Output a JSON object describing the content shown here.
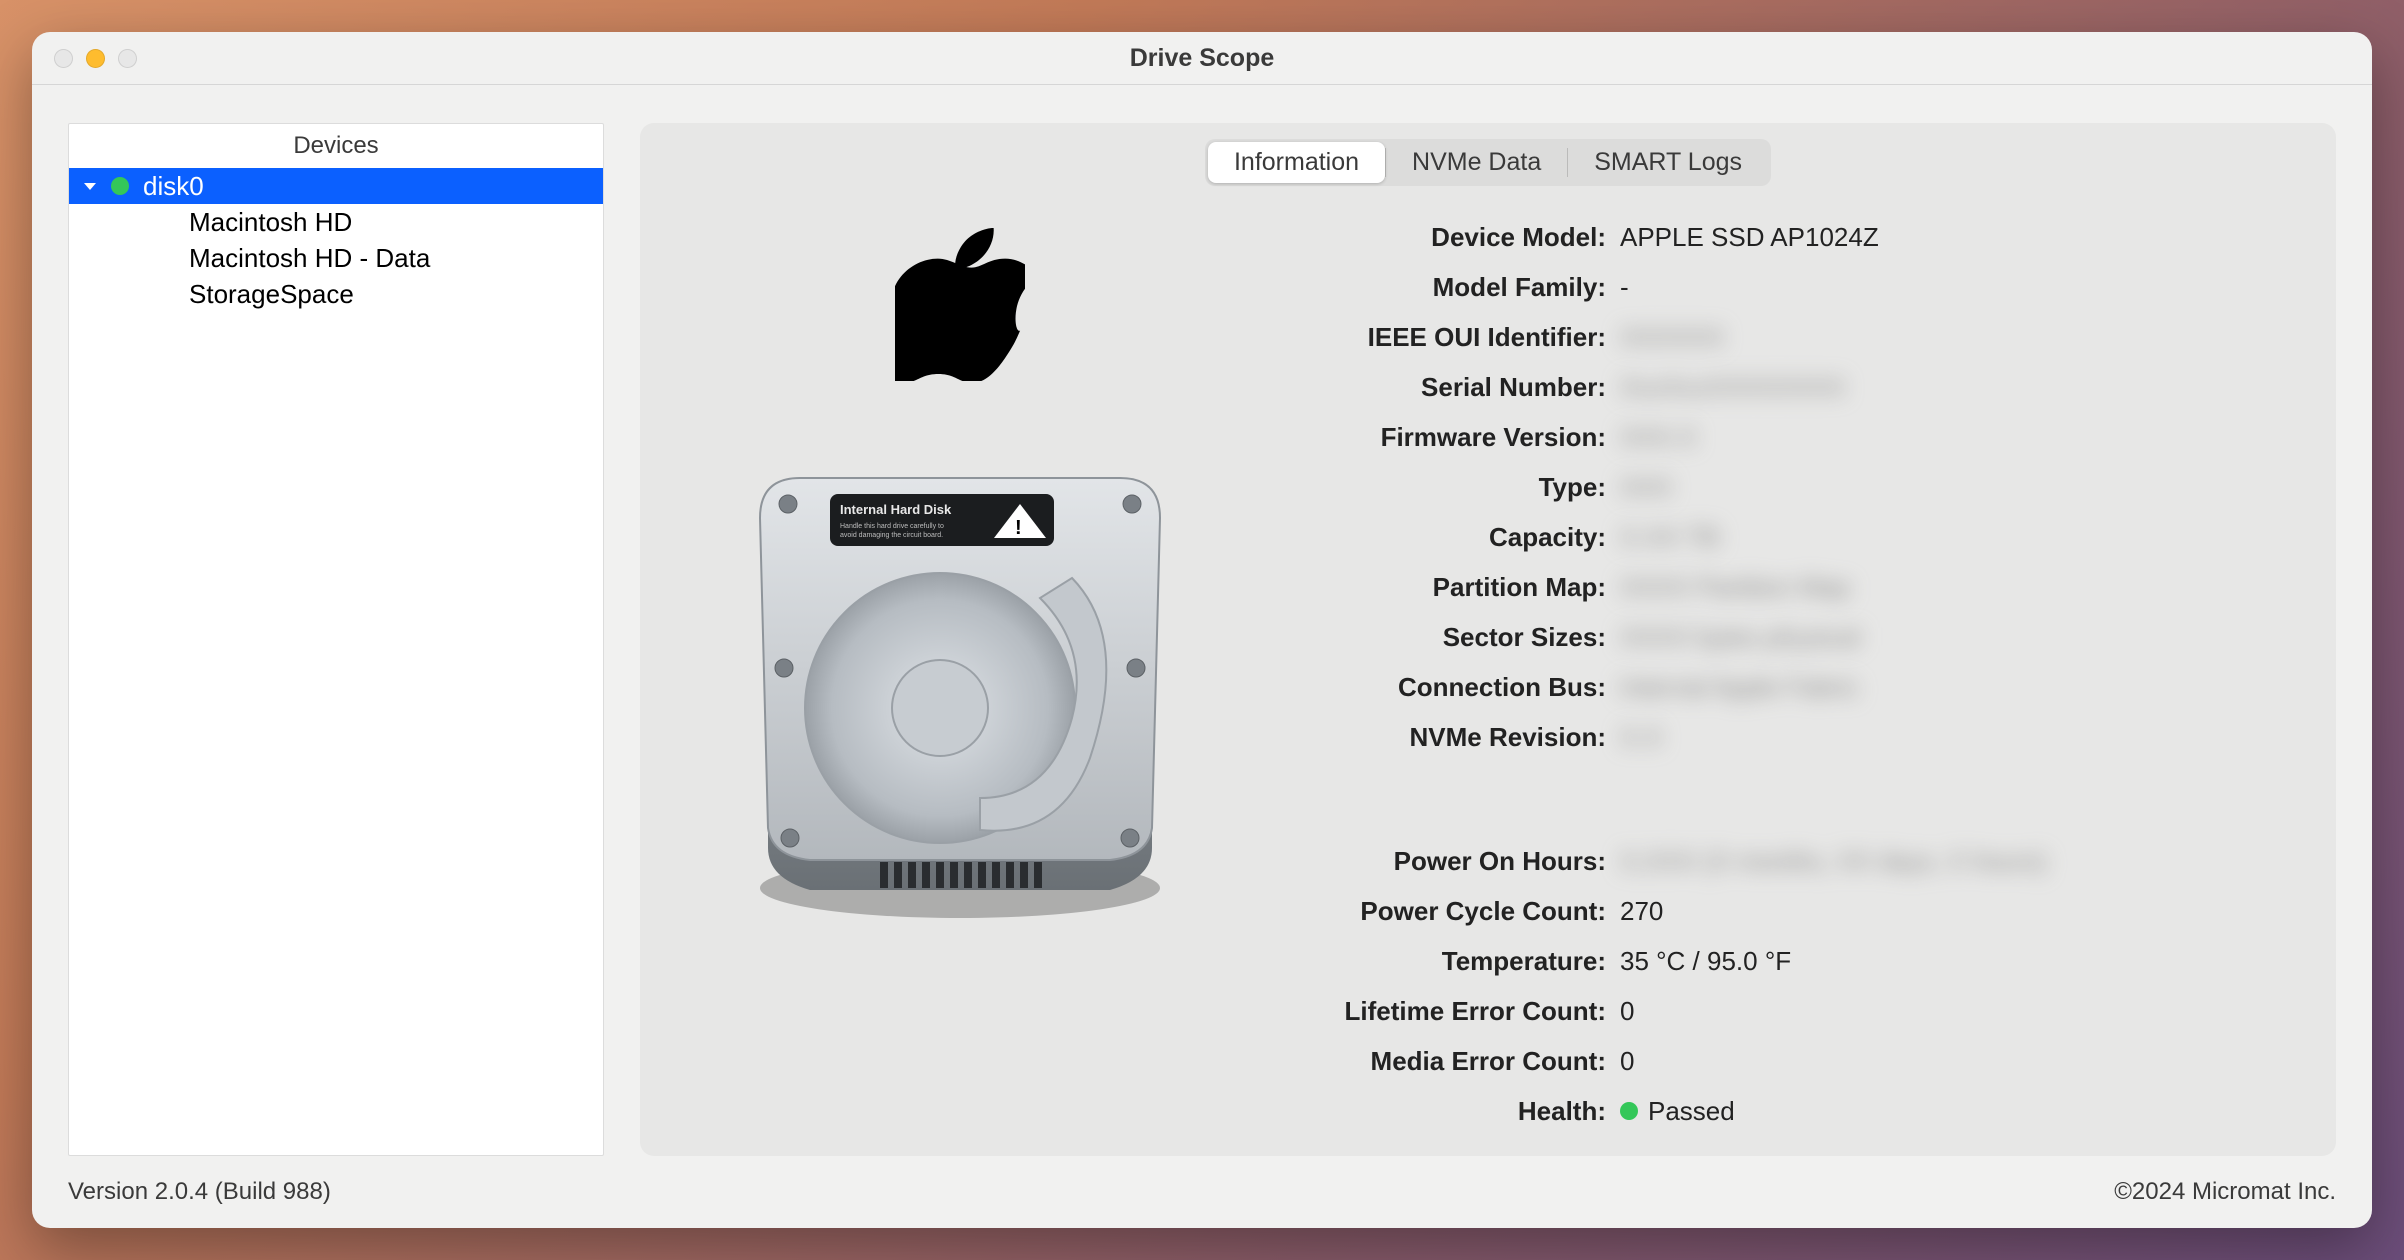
{
  "window": {
    "title": "Drive Scope"
  },
  "sidebar": {
    "header": "Devices",
    "root": {
      "name": "disk0",
      "status": "green"
    },
    "children": [
      "Macintosh HD",
      "Macintosh HD - Data",
      "StorageSpace"
    ]
  },
  "tabs": {
    "items": [
      "Information",
      "NVMe Data",
      "SMART Logs"
    ],
    "active": 0
  },
  "info": {
    "device_model": {
      "label": "Device Model:",
      "value": "APPLE SSD AP1024Z",
      "redacted": false
    },
    "model_family": {
      "label": "Model Family:",
      "value": "-",
      "redacted": false
    },
    "ieee_oui": {
      "label": "IEEE OUI Identifier:",
      "value": "XXXXXX",
      "redacted": true
    },
    "serial_number": {
      "label": "Serial Number:",
      "value": "XxxXxxXXXXXXXX",
      "redacted": true
    },
    "firmware_version": {
      "label": "Firmware Version:",
      "value": "XXX.X",
      "redacted": true
    },
    "type": {
      "label": "Type:",
      "value": "XXX",
      "redacted": true
    },
    "capacity": {
      "label": "Capacity:",
      "value": "X.XX TB",
      "redacted": true
    },
    "partition_map": {
      "label": "Partition Map:",
      "value": "XXXX Partition Map",
      "redacted": true
    },
    "sector_sizes": {
      "label": "Sector Sizes:",
      "value": "XXXX bytes physical",
      "redacted": true
    },
    "connection_bus": {
      "label": "Connection Bus:",
      "value": "Internal Apple Fabric",
      "redacted": true
    },
    "nvme_revision": {
      "label": "NVMe Revision:",
      "value": "X.X",
      "redacted": true
    },
    "power_on_hours": {
      "label": "Power On Hours:",
      "value": "X,XXX (X months, XX days, X hours)",
      "redacted": true
    },
    "power_cycle_count": {
      "label": "Power Cycle Count:",
      "value": "270",
      "redacted": false
    },
    "temperature": {
      "label": "Temperature:",
      "value": "35 °C / 95.0 °F",
      "redacted": false
    },
    "lifetime_error": {
      "label": "Lifetime Error Count:",
      "value": "0",
      "redacted": false
    },
    "media_error": {
      "label": "Media Error Count:",
      "value": "0",
      "redacted": false
    },
    "health": {
      "label": "Health:",
      "value": "Passed",
      "redacted": false,
      "status": "green"
    }
  },
  "footer": {
    "version": "Version 2.0.4 (Build 988)",
    "copyright": "©2024 Micromat Inc."
  }
}
